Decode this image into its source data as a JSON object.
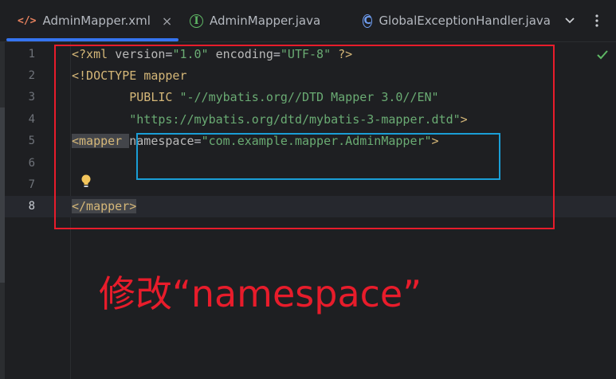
{
  "tabs": [
    {
      "label": "AdminMapper.xml",
      "icon": "xml-file-icon",
      "active": true
    },
    {
      "label": "AdminMapper.java",
      "icon": "interface-icon",
      "active": false
    },
    {
      "label": "GlobalExceptionHandler.java",
      "icon": "class-icon",
      "active": false
    }
  ],
  "tab_close_glyph": "×",
  "line_numbers": [
    "1",
    "2",
    "3",
    "4",
    "5",
    "6",
    "7",
    "8"
  ],
  "current_line": "8",
  "code": {
    "l1": {
      "a": "<?xml ",
      "b": "version",
      "c": "=",
      "d": "\"1.0\"",
      "e": " ",
      "f": "encoding",
      "g": "=",
      "h": "\"UTF-8\"",
      "i": " ?>"
    },
    "l2": {
      "a": "<!DOCTYPE ",
      "b": "mapper"
    },
    "l3": {
      "a": "        PUBLIC ",
      "b": "\"-//mybatis.org//DTD Mapper 3.0//EN\""
    },
    "l4": {
      "a": "        ",
      "b": "\"https://mybatis.org/dtd/mybatis-3-mapper.dtd\"",
      "c": ">"
    },
    "l5": {
      "a": "<mapper",
      "b": " ",
      "c": "namespace",
      "d": "=",
      "e": "\"com.example.mapper.AdminMapper\"",
      "f": ">"
    },
    "l8": {
      "a": "</mapper>"
    }
  },
  "annotation_text": "修改“namespace”",
  "colors": {
    "annotation_red": "#e81c2b",
    "highlight_blue": "#1a9ed6",
    "tab_underline": "#3574f0"
  }
}
